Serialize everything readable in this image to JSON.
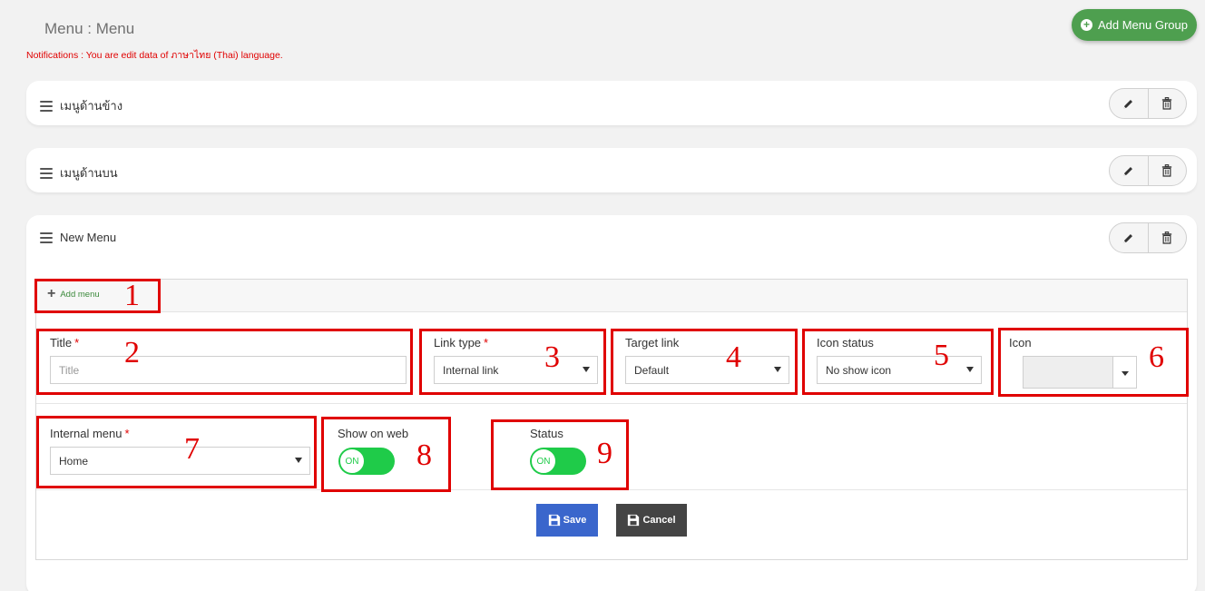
{
  "header": {
    "title": "Menu : Menu",
    "notification": "Notifications : You are edit data of ภาษาไทย (Thai) language.",
    "add_group_label": "Add Menu Group"
  },
  "menu_groups": [
    {
      "title": "เมนูด้านข้าง"
    },
    {
      "title": "เมนูด้านบน"
    },
    {
      "title": "New Menu"
    }
  ],
  "editor": {
    "add_menu_label": "Add menu",
    "title_label": "Title",
    "title_placeholder": "Title",
    "link_type_label": "Link type",
    "link_type_value": "Internal link",
    "target_link_label": "Target link",
    "target_link_value": "Default",
    "icon_status_label": "Icon status",
    "icon_status_value": "No show icon",
    "icon_label": "Icon",
    "internal_menu_label": "Internal menu",
    "internal_menu_value": "Home",
    "show_on_web_label": "Show on web",
    "show_on_web_state": "ON",
    "status_label": "Status",
    "status_state": "ON",
    "required_mark": "*",
    "save_label": "Save",
    "cancel_label": "Cancel"
  },
  "annotations": [
    "1",
    "2",
    "3",
    "4",
    "5",
    "6",
    "7",
    "8",
    "9"
  ],
  "colors": {
    "accent_green": "#4e9f4f",
    "toggle_green": "#1fcb49",
    "save_blue": "#3a66cc",
    "cancel_dark": "#444444",
    "annotation_red": "#e00000"
  }
}
